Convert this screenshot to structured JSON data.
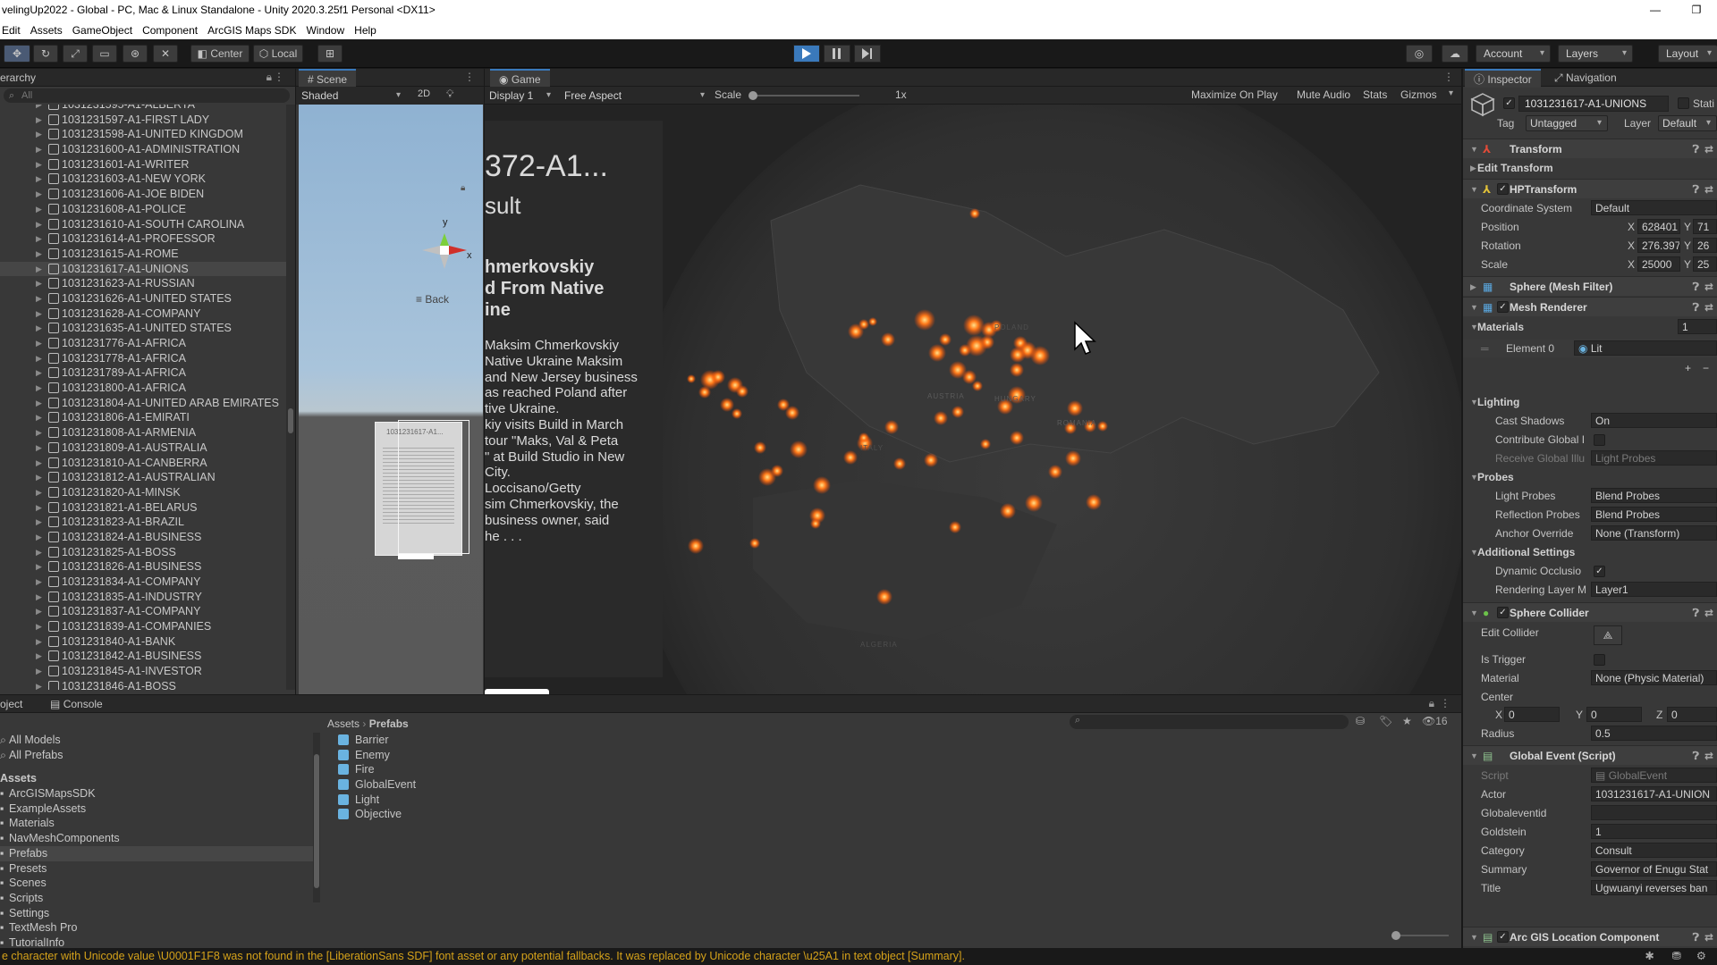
{
  "window": {
    "title": "velingUp2022 - Global - PC, Mac & Linux Standalone - Unity 2020.3.25f1 Personal <DX11>",
    "controls": [
      "—",
      "❐"
    ]
  },
  "menu": [
    "Edit",
    "Assets",
    "GameObject",
    "Component",
    "ArcGIS Maps SDK",
    "Window",
    "Help"
  ],
  "toolbar": {
    "pivot": "Center",
    "space": "Local",
    "account": "Account",
    "layers": "Layers",
    "layout": "Layout"
  },
  "hierarchy": {
    "tab": "erarchy",
    "search_placeholder": "All",
    "items": [
      "1031231595-A1-ALBERTA",
      "1031231597-A1-FIRST LADY",
      "1031231598-A1-UNITED KINGDOM",
      "1031231600-A1-ADMINISTRATION",
      "1031231601-A1-WRITER",
      "1031231603-A1-NEW YORK",
      "1031231606-A1-JOE BIDEN",
      "1031231608-A1-POLICE",
      "1031231610-A1-SOUTH CAROLINA",
      "1031231614-A1-PROFESSOR",
      "1031231615-A1-ROME",
      "1031231617-A1-UNIONS",
      "1031231623-A1-RUSSIAN",
      "1031231626-A1-UNITED STATES",
      "1031231628-A1-COMPANY",
      "1031231635-A1-UNITED STATES",
      "1031231776-A1-AFRICA",
      "1031231778-A1-AFRICA",
      "1031231789-A1-AFRICA",
      "1031231800-A1-AFRICA",
      "1031231804-A1-UNITED ARAB EMIRATES",
      "1031231806-A1-EMIRATI",
      "1031231808-A1-ARMENIA",
      "1031231809-A1-AUSTRALIA",
      "1031231810-A1-CANBERRA",
      "1031231812-A1-AUSTRALIAN",
      "1031231820-A1-MINSK",
      "1031231821-A1-BELARUS",
      "1031231823-A1-BRAZIL",
      "1031231824-A1-BUSINESS",
      "1031231825-A1-BOSS",
      "1031231826-A1-BUSINESS",
      "1031231834-A1-COMPANY",
      "1031231835-A1-INDUSTRY",
      "1031231837-A1-COMPANY",
      "1031231839-A1-COMPANIES",
      "1031231840-A1-BANK",
      "1031231842-A1-BUSINESS",
      "1031231845-A1-INVESTOR",
      "1031231846-A1-BOSS"
    ],
    "selected_index": 11
  },
  "scene": {
    "tab": "Scene",
    "shading": "Shaded",
    "mode2d": "2D",
    "gizmo_y": "y",
    "gizmo_x": "x",
    "back": "≡ Back",
    "card_title": "1031231617-A1..."
  },
  "game": {
    "tab": "Game",
    "display": "Display 1",
    "aspect": "Free Aspect",
    "scale_label": "Scale",
    "scale_value": "1x",
    "options": [
      "Maximize On Play",
      "Mute Audio",
      "Stats",
      "Gizmos"
    ],
    "card": {
      "title": "372-A1...",
      "subtitle": "sult",
      "headline": [
        "hmerkovskiy",
        "d From Native",
        "ine"
      ],
      "body": [
        "Maksim Chmerkovskiy",
        "Native Ukraine Maksim",
        "and New Jersey business",
        "as reached Poland after",
        "tive Ukraine.",
        "kiy visits Build in March",
        "tour \"Maks, Val & Peta",
        "\" at Build Studio in New",
        "City.",
        "Loccisano/Getty",
        "sim Chmerkovskiy, the",
        "business owner, said",
        "he . . ."
      ]
    },
    "map_labels": [
      "AUSTRIA",
      "HUNGARY",
      "ROMANIA",
      "ALGERIA",
      "ITALY",
      "POLAND"
    ]
  },
  "inspector": {
    "tabs": [
      "Inspector",
      "Navigation"
    ],
    "object_name": "1031231617-A1-UNIONS",
    "static_label": "Stati",
    "tag_label": "Tag",
    "tag_value": "Untagged",
    "layer_label": "Layer",
    "layer_value": "Default",
    "transform": {
      "name": "Transform",
      "edit": "Edit Transform"
    },
    "hptransform": {
      "name": "HPTransform",
      "coord_label": "Coordinate System",
      "coord_value": "Default",
      "position_label": "Position",
      "position_x": "628401",
      "position_y": "71",
      "rotation_label": "Rotation",
      "rotation_x": "276.397",
      "rotation_y": "26",
      "scale_label": "Scale",
      "scale_x": "25000",
      "scale_y": "25"
    },
    "mesh_filter": "Sphere (Mesh Filter)",
    "mesh_renderer": {
      "name": "Mesh Renderer",
      "materials_label": "Materials",
      "materials_count": "1",
      "element0_label": "Element 0",
      "element0_value": "Lit",
      "lighting_label": "Lighting",
      "cast_shadows_label": "Cast Shadows",
      "cast_shadows_value": "On",
      "contribute_gi_label": "Contribute Global I",
      "receive_gi_label": "Receive Global Illu",
      "receive_gi_value": "Light Probes",
      "probes_label": "Probes",
      "light_probes_label": "Light Probes",
      "light_probes_value": "Blend Probes",
      "reflection_probes_label": "Reflection Probes",
      "reflection_probes_value": "Blend Probes",
      "anchor_label": "Anchor Override",
      "anchor_value": "None (Transform)",
      "additional_label": "Additional Settings",
      "dynamic_occ_label": "Dynamic Occlusio",
      "rendering_layer_label": "Rendering Layer M",
      "rendering_layer_value": "Layer1"
    },
    "sphere_collider": {
      "name": "Sphere Collider",
      "edit_label": "Edit Collider",
      "trigger_label": "Is Trigger",
      "material_label": "Material",
      "material_value": "None (Physic Material)",
      "center_label": "Center",
      "cx": "0",
      "cy": "0",
      "cz": "0",
      "radius_label": "Radius",
      "radius_value": "0.5"
    },
    "global_event": {
      "name": "Global Event (Script)",
      "script_label": "Script",
      "script_value": "GlobalEvent",
      "actor_label": "Actor",
      "actor_value": "1031231617-A1-UNION",
      "globaleventid_label": "Globaleventid",
      "goldstein_label": "Goldstein",
      "goldstein_value": "1",
      "category_label": "Category",
      "category_value": "Consult",
      "summary_label": "Summary",
      "summary_value": "Governor of Enugu Stat",
      "title_label": "Title",
      "title_value": "Ugwuanyi reverses ban"
    },
    "arcgis_location": "Arc GIS Location Component"
  },
  "project": {
    "tabs": [
      "oject",
      "Console"
    ],
    "favorites": [
      "All Models",
      "All Prefabs"
    ],
    "assets_label": "Assets",
    "folders": [
      "ArcGISMapsSDK",
      "ExampleAssets",
      "Materials",
      "NavMeshComponents",
      "Prefabs",
      "Presets",
      "Scenes",
      "Scripts",
      "Settings",
      "TextMesh Pro",
      "TutorialInfo"
    ],
    "selected_folder": "Prefabs",
    "breadcrumb": [
      "Assets",
      "Prefabs"
    ],
    "files": [
      "Barrier",
      "Enemy",
      "Fire",
      "GlobalEvent",
      "Light",
      "Objective"
    ],
    "hidden_count": "16"
  },
  "status": "e character with Unicode value \\U0001F1F8 was not found in the [LiberationSans SDF] font asset or any potential fallbacks. It was replaced by Unicode character \\u25A1 in text object [Summary].",
  "colors": {
    "accent": "#3a79bb",
    "warning": "#d5a21a",
    "fire": "#ff6a1a"
  }
}
